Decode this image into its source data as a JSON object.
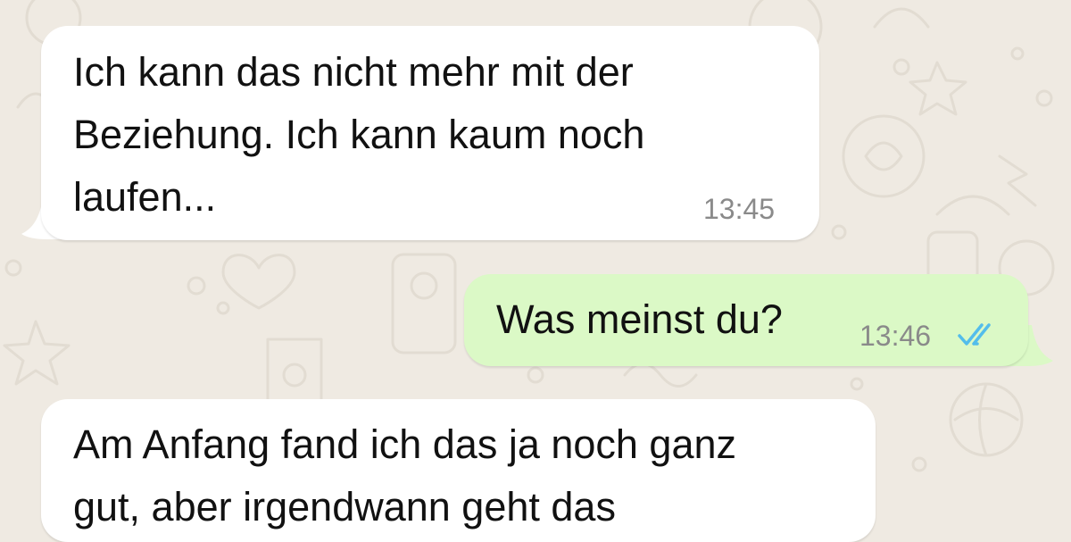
{
  "chat": {
    "messages": [
      {
        "direction": "incoming",
        "text": "Ich kann das nicht mehr mit der\nBeziehung. Ich kann kaum noch\nlaufen...",
        "time": "13:45"
      },
      {
        "direction": "outgoing",
        "text": "Was meinst du?",
        "time": "13:46",
        "status_icon": "double-check-read-icon"
      },
      {
        "direction": "incoming",
        "text": "Am Anfang fand ich das ja noch ganz\ngut, aber irgendwann geht das"
      }
    ]
  },
  "colors": {
    "background": "#efeae2",
    "incoming_bubble": "#ffffff",
    "outgoing_bubble": "#dbf9c6",
    "read_ticks": "#53bdeb",
    "timestamp": "#8a8a8a"
  }
}
